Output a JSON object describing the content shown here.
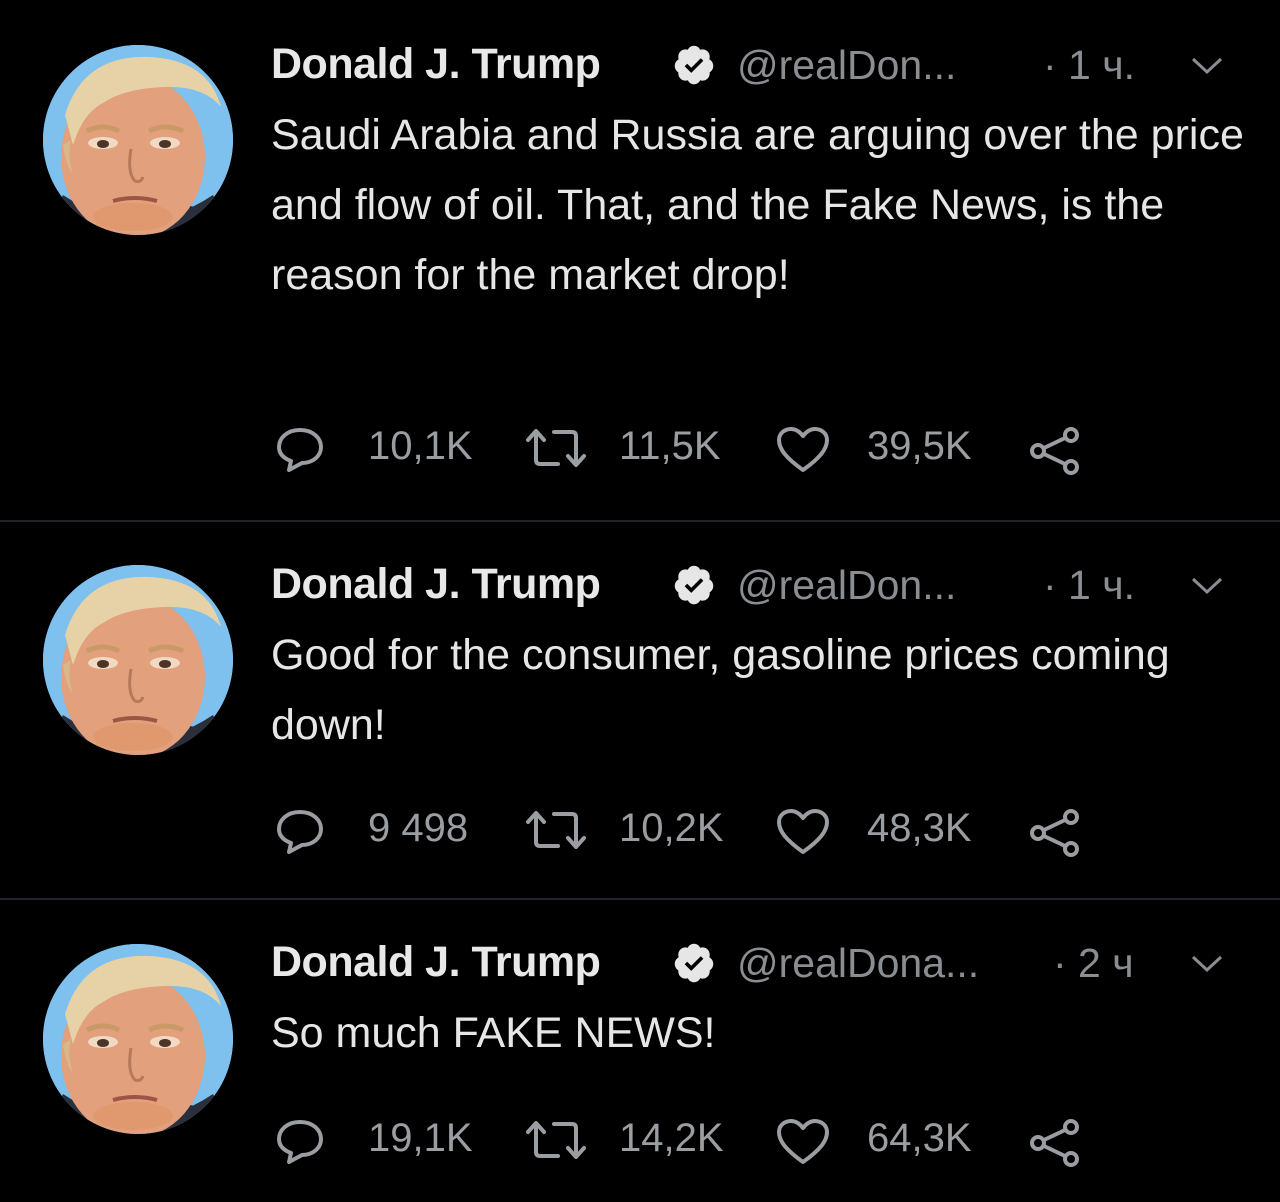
{
  "colors": {
    "background": "#000000",
    "divider": "#202327",
    "text_primary": "#e6e6e6",
    "text_secondary": "#8a8d91",
    "icon": "#9a9da1"
  },
  "icons": {
    "reply": "speech-bubble-icon",
    "retweet": "retweet-arrows-icon",
    "like": "heart-outline-icon",
    "share": "share-nodes-icon",
    "verified": "verified-badge-icon",
    "more": "chevron-down-icon"
  },
  "tweets": [
    {
      "name": "Donald J. Trump",
      "handle": "@realDon...",
      "time": "· 1 ч.",
      "text": "Saudi Arabia and Russia are arguing over the price and flow of oil. That, and the Fake News, is the reason for the market drop!",
      "replies": "10,1K",
      "retweets": "11,5K",
      "likes": "39,5K"
    },
    {
      "name": "Donald J. Trump",
      "handle": "@realDon...",
      "time": "· 1 ч.",
      "text": "Good for the consumer, gasoline prices coming down!",
      "replies": "9 498",
      "retweets": "10,2K",
      "likes": "48,3K"
    },
    {
      "name": "Donald J. Trump",
      "handle": "@realDona...",
      "time": "· 2 ч",
      "text": "So much FAKE NEWS!",
      "replies": "19,1K",
      "retweets": "14,2K",
      "likes": "64,3K"
    }
  ]
}
